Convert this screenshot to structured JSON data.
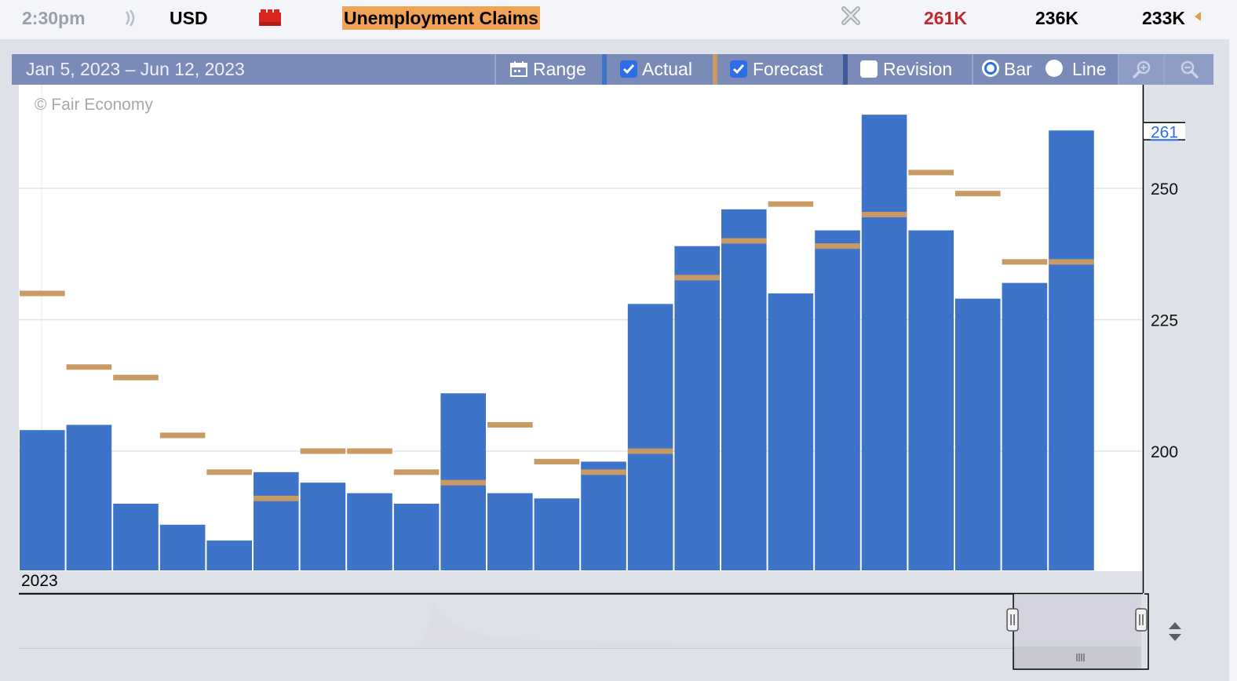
{
  "event": {
    "time": "2:30pm",
    "currency": "USD",
    "name": "Unemployment Claims",
    "actual": "261K",
    "forecast": "236K",
    "previous": "233K",
    "impact_color": "#d8261f",
    "actual_color": "#c2272d"
  },
  "toolbar": {
    "date_range": "Jan 5, 2023 – Jun 12, 2023",
    "range_label": "Range",
    "actual_label": "Actual",
    "actual_checked": true,
    "forecast_label": "Forecast",
    "forecast_checked": true,
    "revision_label": "Revision",
    "revision_checked": false,
    "bar_label": "Bar",
    "line_label": "Line",
    "mode": "Bar",
    "zoom_in_icon": "zoom-in-icon",
    "zoom_out_icon": "zoom-out-icon"
  },
  "chart_data": {
    "type": "bar",
    "copyright": "© Fair Economy",
    "x_label": "2023",
    "ylim": [
      177,
      262
    ],
    "y_ticks": [
      200,
      225,
      250
    ],
    "y_axis_side": "right",
    "current_value_label": "261",
    "grid": true,
    "colors": {
      "actual": "#3d73c8",
      "forecast": "#c89a64"
    },
    "series": [
      {
        "name": "Actual",
        "values": [
          204,
          205,
          190,
          186,
          183,
          196,
          194,
          192,
          190,
          211,
          192,
          191,
          198,
          228,
          239,
          246,
          230,
          242,
          264,
          242,
          229,
          232,
          261
        ]
      },
      {
        "name": "Forecast",
        "values": [
          230,
          216,
          214,
          203,
          196,
          191,
          200,
          200,
          196,
          194,
          205,
          198,
          196,
          200,
          233,
          240,
          247,
          239,
          245,
          253,
          249,
          236,
          236
        ]
      }
    ]
  },
  "navigator": {
    "series": [
      0,
      0,
      0,
      0,
      0,
      0,
      0,
      0,
      0,
      0,
      0,
      0,
      0,
      0,
      0,
      0,
      0,
      0,
      0,
      0,
      0,
      0,
      0,
      0,
      0,
      0,
      0,
      0,
      0,
      0,
      0,
      0,
      0,
      0,
      0,
      0,
      0,
      0,
      0,
      0,
      0,
      0,
      0,
      0,
      0,
      0,
      0,
      1,
      6.2,
      4.6,
      3.6,
      2.8,
      2.3,
      1.9,
      1.6,
      1.4,
      1.25,
      1.15,
      1.05,
      0.98,
      0.92,
      0.87,
      0.83,
      0.8,
      0.78,
      0.75,
      0.73,
      0.71,
      0.69,
      0.68,
      0.66,
      0.65,
      0.64,
      0.63,
      0.62,
      0.61,
      0.6,
      0.59,
      0.58,
      0.57,
      0.56,
      0.55,
      0.55,
      0.54,
      0.53,
      0.53,
      0.52,
      0.52,
      0.51,
      0.51,
      0.5,
      0.5,
      0.5,
      0.49,
      0.49,
      0.49,
      0.48,
      0.48,
      0.48,
      0.47,
      0.47,
      0.47,
      0.47,
      0.46,
      0.46,
      0.46,
      0.46,
      0.45,
      0.45,
      0.45,
      0.45,
      0.45,
      0.44,
      0.44,
      0.44,
      0.44,
      0.44,
      0.43,
      0.43,
      0.43,
      0.43,
      0.43,
      0.42,
      0.42,
      0.42,
      0.42,
      0.42,
      0.41,
      0.41,
      0.41,
      0.41
    ],
    "selection_start_fraction": 0.882,
    "selection_end_fraction": 1.0
  }
}
